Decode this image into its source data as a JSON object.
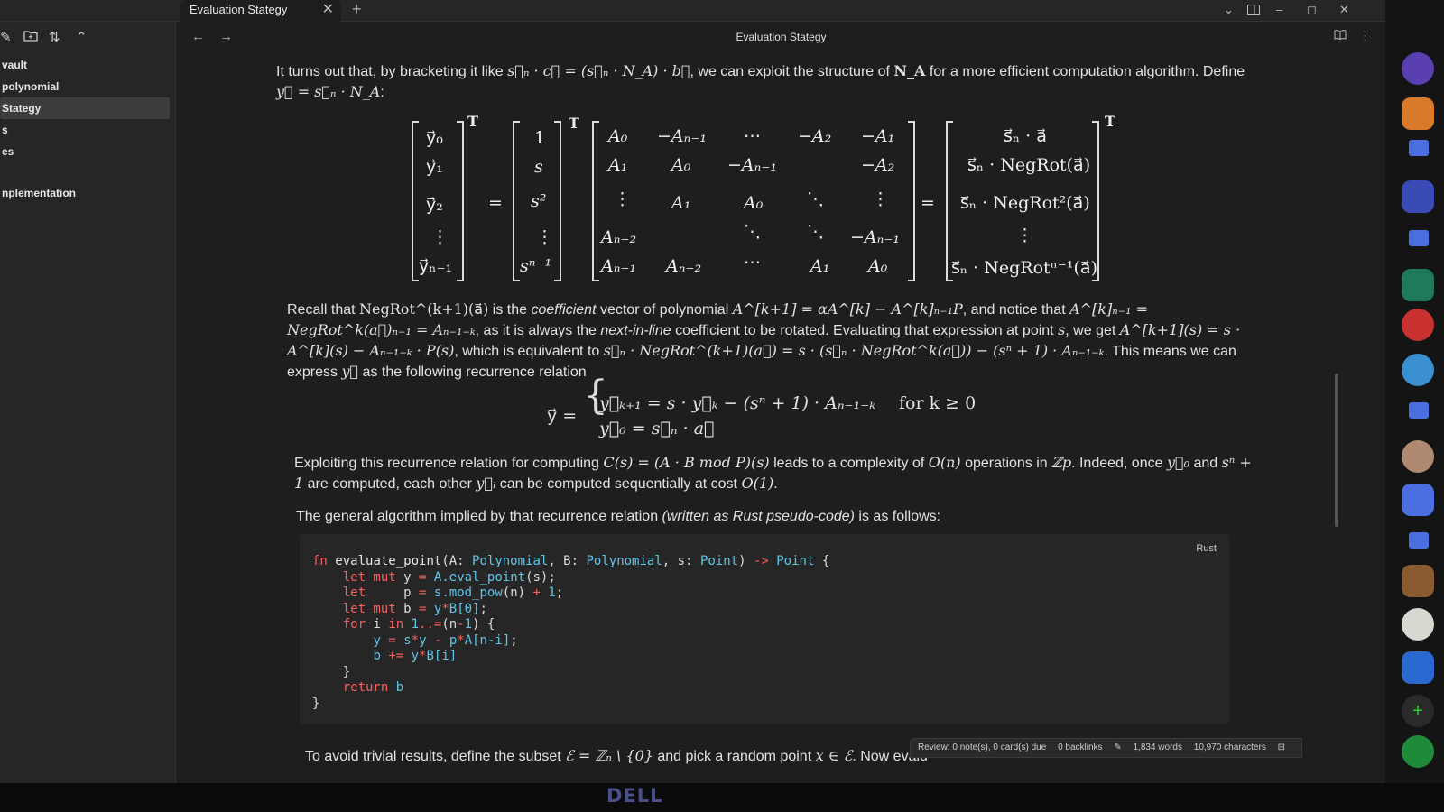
{
  "tab": {
    "title": "Evaluation Stategy",
    "close": "✕",
    "new": "+"
  },
  "window_controls": {
    "chevron": "⌄",
    "minimize": "–",
    "maximize": "◻",
    "close": "✕"
  },
  "sidebar": {
    "tools": [
      "new-note-icon",
      "new-folder-icon",
      "sort-icon",
      "collapse-icon"
    ],
    "items": [
      {
        "label": "vault",
        "active": false
      },
      {
        "label": "polynomial",
        "active": false
      },
      {
        "label": "Stategy",
        "active": true
      },
      {
        "label": "s",
        "active": false
      },
      {
        "label": "es",
        "active": false
      },
      {
        "label": "nplementation",
        "active": false
      }
    ]
  },
  "header": {
    "title": "Evaluation Stategy",
    "back": "←",
    "forward": "→"
  },
  "content": {
    "p1_a": "It turns out that, by bracketing it like ",
    "p1_m1": "s⃗ₙ · c⃗ = (s⃗ₙ · N_A) · b⃗",
    "p1_b": ", we can exploit the structure of ",
    "p1_m2": "N_A",
    "p1_c": " for a more efficient computation algorithm. Define ",
    "p1_m3": "y⃗ = s⃗ₙ · N_A",
    "p1_d": ":",
    "matrix": {
      "T": "T",
      "lhs": [
        "y⃗₀",
        "y⃗₁",
        "y⃗₂",
        "⋮",
        "y⃗ₙ₋₁"
      ],
      "eq": "=",
      "svec": [
        "1",
        "s",
        "s²",
        "⋮",
        "sⁿ⁻¹"
      ],
      "NA": [
        [
          "A₀",
          "−Aₙ₋₁",
          "⋯",
          "−A₂",
          "−A₁"
        ],
        [
          "A₁",
          "A₀",
          "−Aₙ₋₁",
          "",
          "−A₂"
        ],
        [
          "⋮",
          "A₁",
          "A₀",
          "⋱",
          "⋮"
        ],
        [
          "Aₙ₋₂",
          "",
          "⋱",
          "⋱",
          "−Aₙ₋₁"
        ],
        [
          "Aₙ₋₁",
          "Aₙ₋₂",
          "⋯",
          "A₁",
          "A₀"
        ]
      ],
      "rhs": [
        "s⃗ₙ · a⃗",
        "s⃗ₙ · NegRot(a⃗)",
        "s⃗ₙ · NegRot²(a⃗)",
        "⋮",
        "s⃗ₙ · NegRotⁿ⁻¹(a⃗)"
      ]
    },
    "p2_a": "Recall that ",
    "p2_m1": "NegRot^(k+1)(a⃗)",
    "p2_b": " is the ",
    "p2_em1": "coefficient",
    "p2_c": " vector of polynomial ",
    "p2_m2": "A^[k+1] = αA^[k] − A^[k]ₙ₋₁P",
    "p2_d": ", and notice that ",
    "p2_m3": "A^[k]ₙ₋₁ = NegRot^k(a⃗)ₙ₋₁ = Aₙ₋₁₋ₖ",
    "p2_e": ", as it is always the ",
    "p2_em2": "next-in-line",
    "p2_f": " coefficient to be rotated. Evaluating that expression at point ",
    "p2_m4": "s",
    "p2_g": ", we get ",
    "p2_m5": "A^[k+1](s) = s · A^[k](s) − Aₙ₋₁₋ₖ · P(s)",
    "p2_h": ", which is equivalent to ",
    "p2_m6": "s⃗ₙ · NegRot^(k+1)(a⃗) = s · (s⃗ₙ · NegRot^k(a⃗)) − (sⁿ + 1) · Aₙ₋₁₋ₖ",
    "p2_i": ". This means we can express ",
    "p2_m7": "y⃗",
    "p2_j": " as the following recurrence relation",
    "recur": {
      "lhs": "y⃗ =",
      "line1": "y⃗ₖ₊₁ = s · y⃗ₖ − (sⁿ + 1) · Aₙ₋₁₋ₖ",
      "line2": "y⃗₀ = s⃗ₙ · a⃗",
      "cond": "for  k ≥ 0"
    },
    "p3_a": "Exploiting this recurrence relation for computing ",
    "p3_m1": "C(s) = (A · B  mod  P)(s)",
    "p3_b": " leads to a complexity of ",
    "p3_m2": "O(n)",
    "p3_c": " operations in ",
    "p3_m3": "ℤp",
    "p3_d": ". Indeed, once ",
    "p3_m4": "y⃗₀",
    "p3_e": " and ",
    "p3_m5": "sⁿ + 1",
    "p3_f": " are computed, each other ",
    "p3_m6": "y⃗ᵢ",
    "p3_g": " can be computed sequentially at cost ",
    "p3_m7": "O(1)",
    "p3_h": ".",
    "p4_a": "The general algorithm implied by that recurrence relation ",
    "p4_em": "(written as Rust pseudo-code)",
    "p4_b": " is as follows:",
    "code_lang": "Rust",
    "p5_a": "To avoid trivial results, define the subset ",
    "p5_m1": "ℰ = ℤₙ \\ {0}",
    "p5_b": " and pick a random point ",
    "p5_m2": "x ∈ ℰ",
    "p5_c": ". Now evalu"
  },
  "status": {
    "review": "Review: 0 note(s), 0 card(s) due",
    "backlinks": "0 backlinks",
    "words": "1,834 words",
    "chars": "10,970 characters"
  },
  "bezel": {
    "brand": "DELL"
  },
  "colors": {
    "keyword": "#f55f5f",
    "type": "#60c5e8",
    "background": "#1e1e1e"
  }
}
